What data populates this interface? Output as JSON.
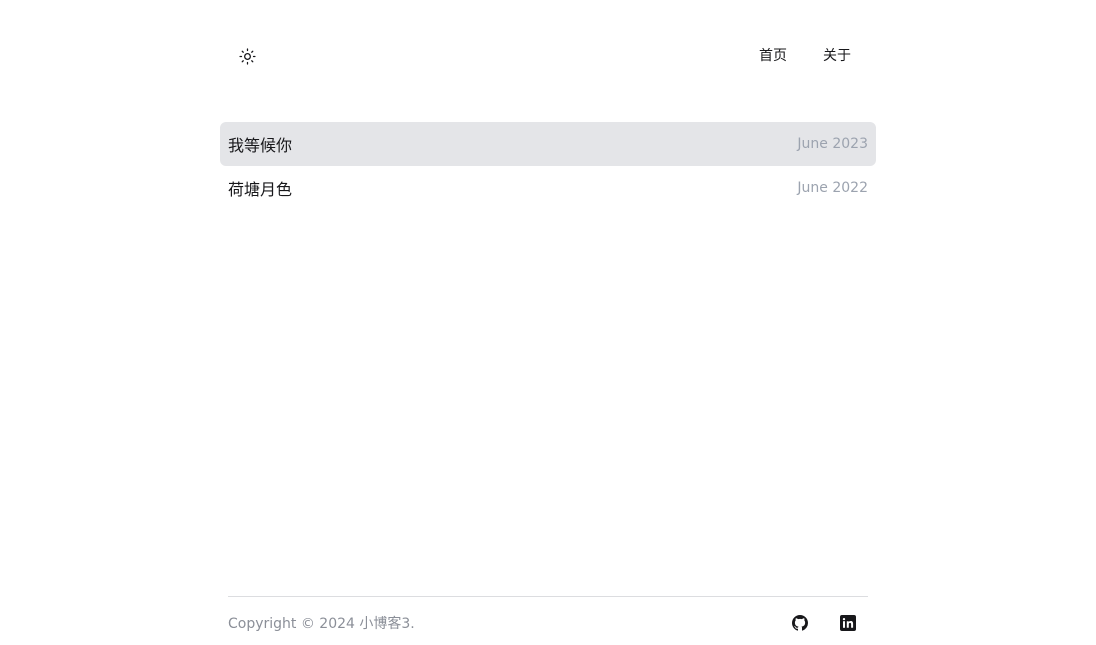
{
  "header": {
    "theme_icon": "sun-icon",
    "nav": [
      {
        "label": "首页"
      },
      {
        "label": "关于"
      }
    ]
  },
  "posts": [
    {
      "title": "我等候你",
      "date": "June 2023",
      "highlighted": true
    },
    {
      "title": "荷塘月色",
      "date": "June 2022",
      "highlighted": false
    }
  ],
  "footer": {
    "copyright": "Copyright © 2024 小博客3.",
    "social": [
      {
        "icon": "github-icon"
      },
      {
        "icon": "linkedin-icon"
      }
    ]
  },
  "colors": {
    "highlight_bg": "#e4e5e8",
    "date_text": "#9ca3af",
    "copyright_text": "#8b8f98"
  }
}
